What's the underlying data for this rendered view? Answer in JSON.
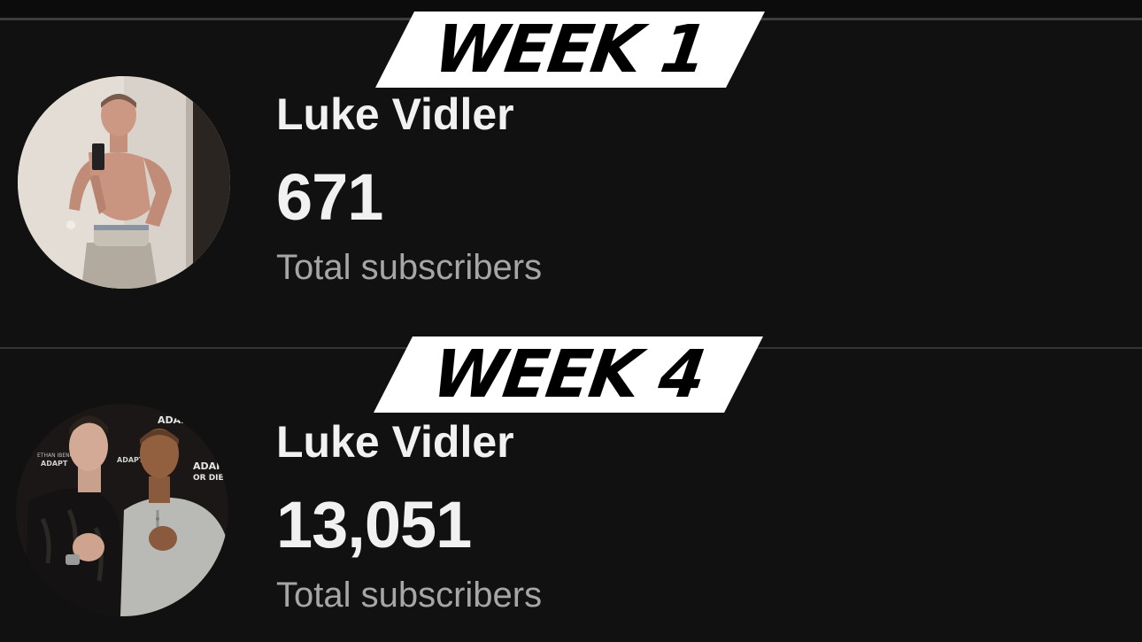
{
  "cards": [
    {
      "week_label": "WEEK 1",
      "channel_name": "Luke Vidler",
      "subscriber_count": "671",
      "subscriber_label": "Total subscribers"
    },
    {
      "week_label": "WEEK 4",
      "channel_name": "Luke Vidler",
      "subscriber_count": "13,051",
      "subscriber_label": "Total subscribers"
    }
  ],
  "avatar_2_backdrop_text": [
    "ADAPT",
    "OR DIE",
    "ETHAN IBENG"
  ],
  "colors": {
    "background": "#111111",
    "text_primary": "#f1f1f1",
    "text_secondary": "#a6a6a6",
    "banner": "#ffffff",
    "banner_text": "#000000"
  }
}
